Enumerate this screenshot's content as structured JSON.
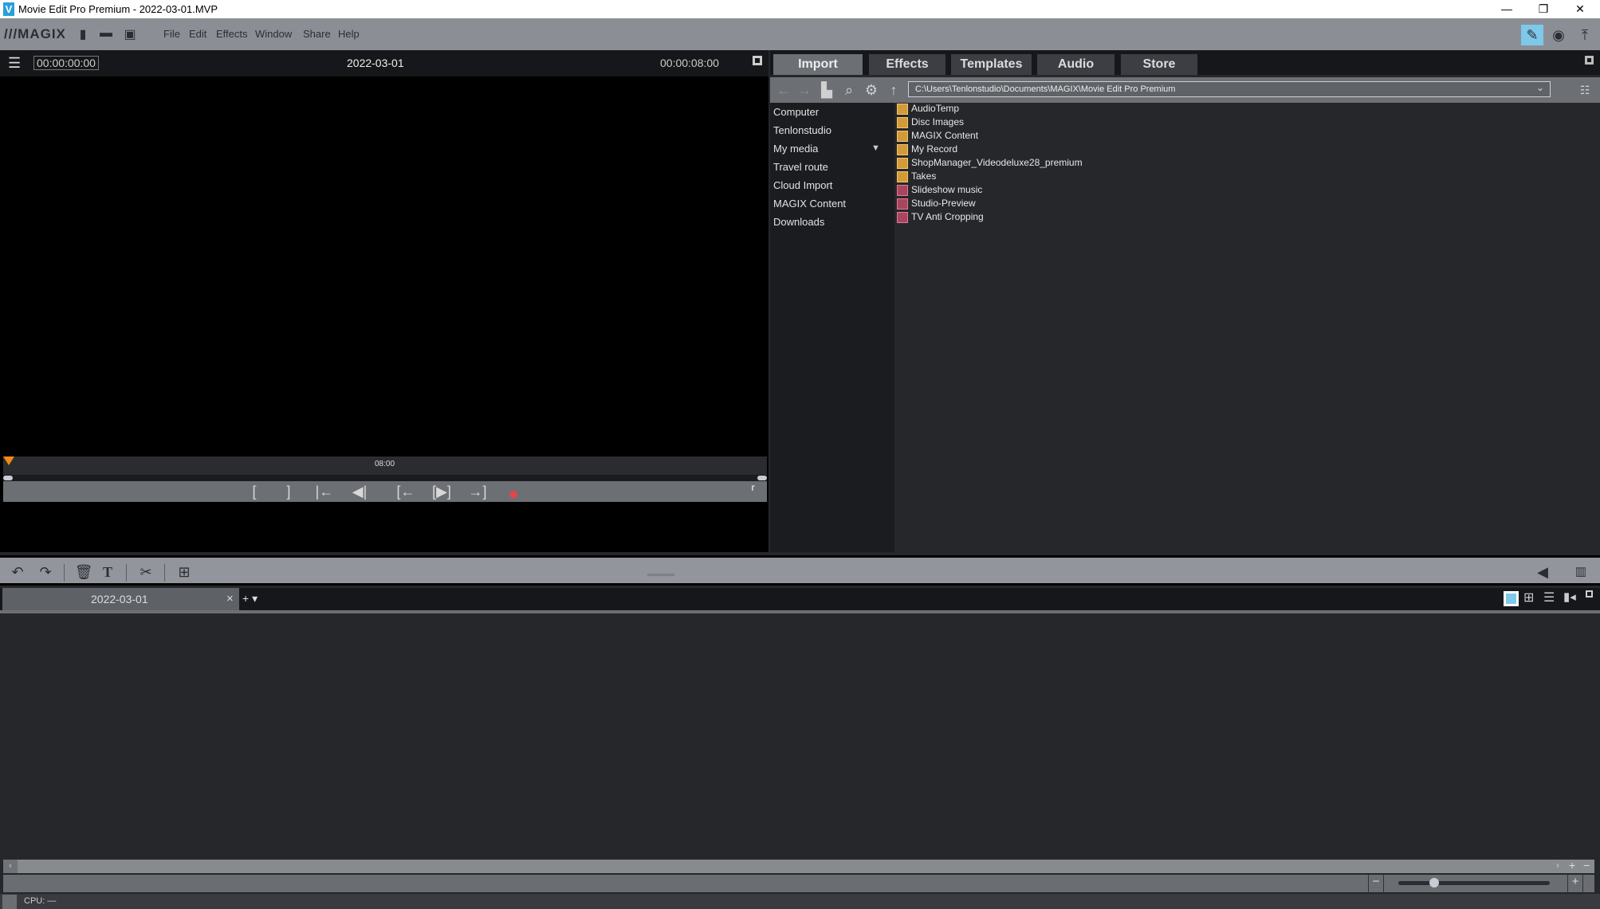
{
  "window": {
    "title": "Movie Edit Pro Premium - 2022-03-01.MVP",
    "controls": [
      "minimize",
      "restore",
      "close"
    ]
  },
  "menubar": {
    "brand": "///MAGIX",
    "file_icons": [
      "new-file-icon",
      "open-folder-icon",
      "save-icon"
    ],
    "menus": [
      "File",
      "Edit",
      "Effects",
      "Window",
      "Share",
      "Help"
    ],
    "right_icons": [
      "edit-mode-icon",
      "disc-burn-icon",
      "upload-icon"
    ]
  },
  "preview": {
    "current_time": "00:00:00:00",
    "project_name": "2022-03-01",
    "total_time": "00:00:08:00",
    "ruler_label": "08:00",
    "controls": {
      "mark_in": "[",
      "mark_out": "]",
      "to_start": "|←",
      "prev_frame": "◀|",
      "prev_marker": "[←",
      "play": "[▶]",
      "next_marker": "→]",
      "record": "●"
    }
  },
  "media": {
    "tabs": [
      "Import",
      "Effects",
      "Templates",
      "Audio",
      "Store"
    ],
    "active_tab": "Import",
    "path": "C:\\Users\\Tenlonstudio\\Documents\\MAGIX\\Movie Edit Pro Premium",
    "sidebar": [
      "Computer",
      "Tenlonstudio",
      "My media",
      "Travel route",
      "Cloud Import",
      "MAGIX Content",
      "Downloads"
    ],
    "files": [
      {
        "name": "AudioTemp",
        "type": "folder"
      },
      {
        "name": "Disc Images",
        "type": "folder"
      },
      {
        "name": "MAGIX Content",
        "type": "folder"
      },
      {
        "name": "My Record",
        "type": "folder"
      },
      {
        "name": "ShopManager_Videodeluxe28_premium",
        "type": "folder"
      },
      {
        "name": "Takes",
        "type": "folder"
      },
      {
        "name": "Slideshow music",
        "type": "link"
      },
      {
        "name": "Studio-Preview",
        "type": "link"
      },
      {
        "name": "TV Anti Cropping",
        "type": "link"
      }
    ],
    "colors": {
      "folder": "#d39a3a",
      "link": "#a8465e"
    }
  },
  "timeline": {
    "tab_label": "2022-03-01",
    "close": "×",
    "add": "+ ▾",
    "view_modes": [
      "storyboard-view",
      "overview-view",
      "timeline-view",
      "multicam-view"
    ],
    "active_view": "storyboard-view"
  },
  "zoom": {
    "minus": "−",
    "plus": "+",
    "level": 0.22
  },
  "status": {
    "cpu": "CPU: —"
  }
}
